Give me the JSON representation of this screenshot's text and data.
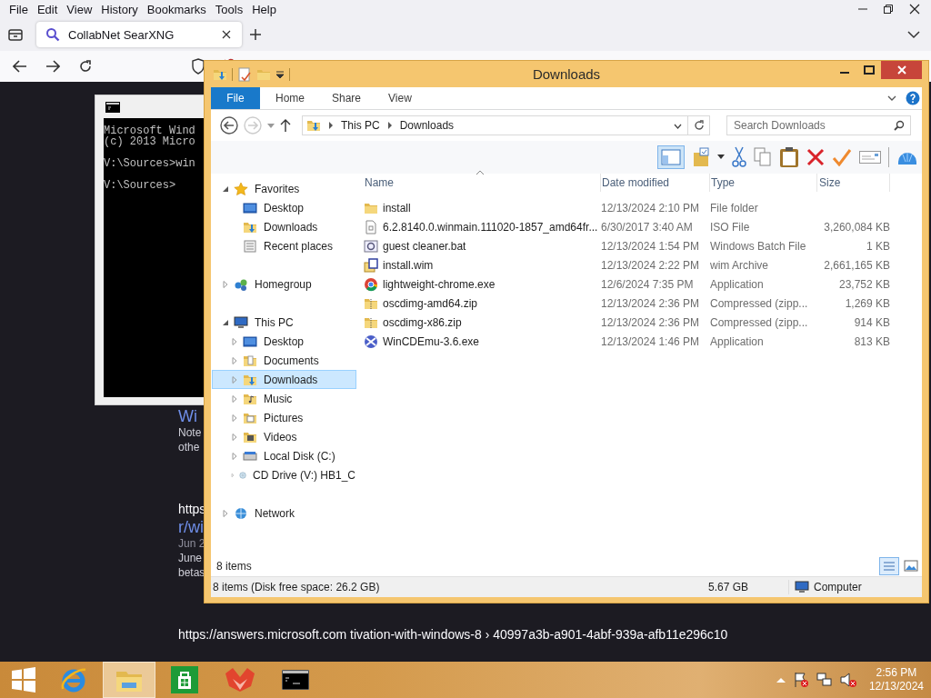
{
  "browser": {
    "menu": [
      "File",
      "Edit",
      "View",
      "History",
      "Bookmarks",
      "Tools",
      "Help"
    ],
    "tabs": [
      {
        "title": "CollabNet SearXNG",
        "selected": true
      }
    ],
    "results": [
      {
        "lines": [
          {
            "kind": "title",
            "text": "Wi"
          },
          {
            "kind": "snippet",
            "text": "Note"
          },
          {
            "kind": "snippet",
            "text": "othe"
          }
        ]
      },
      {
        "lines": [
          {
            "kind": "url",
            "text": "https"
          },
          {
            "kind": "title",
            "text": "r/wi"
          },
          {
            "kind": "date",
            "text": "Jun 2"
          },
          {
            "kind": "snippet",
            "text": "June"
          },
          {
            "kind": "snippet",
            "text": "betas"
          }
        ]
      },
      {
        "lines": [
          {
            "kind": "url",
            "text": "https://answers.microsoft.com  tivation-with-windows-8 › 40997a3b-a901-4abf-939a-afb11e296c10"
          }
        ]
      }
    ]
  },
  "console": {
    "paragraphs": [
      [
        "Microsoft Wind",
        "(c) 2013 Micro"
      ],
      [
        "V:\\Sources>win"
      ],
      [
        "V:\\Sources>"
      ]
    ]
  },
  "explorer": {
    "title": "Downloads",
    "ribbon_tabs": [
      {
        "label": "File",
        "kind": "file"
      },
      {
        "label": "Home",
        "kind": "tab"
      },
      {
        "label": "Share",
        "kind": "tab"
      },
      {
        "label": "View",
        "kind": "tab"
      }
    ],
    "breadcrumb": [
      "This PC",
      "Downloads"
    ],
    "search": {
      "placeholder": "Search Downloads"
    },
    "nav": [
      {
        "label": "Favorites",
        "kind": "star",
        "expanded": true,
        "selected": false,
        "children": [
          {
            "label": "Desktop",
            "kind": "desktop",
            "selected": false
          },
          {
            "label": "Downloads",
            "kind": "downloads",
            "selected": false
          },
          {
            "label": "Recent places",
            "kind": "recent",
            "selected": false
          }
        ]
      },
      {
        "label": "Homegroup",
        "kind": "homegroup",
        "expanded": false,
        "selected": false
      },
      {
        "label": "This PC",
        "kind": "computer",
        "expanded": true,
        "selected": false,
        "children": [
          {
            "label": "Desktop",
            "kind": "desktop",
            "expanded": false,
            "selected": false
          },
          {
            "label": "Documents",
            "kind": "documents",
            "expanded": false,
            "selected": false
          },
          {
            "label": "Downloads",
            "kind": "downloads",
            "expanded": false,
            "selected": true
          },
          {
            "label": "Music",
            "kind": "music",
            "expanded": false,
            "selected": false
          },
          {
            "label": "Pictures",
            "kind": "pictures",
            "expanded": false,
            "selected": false
          },
          {
            "label": "Videos",
            "kind": "videos",
            "expanded": false,
            "selected": false
          },
          {
            "label": "Local Disk (C:)",
            "kind": "disk",
            "expanded": false,
            "selected": false
          },
          {
            "label": "CD Drive (V:) HB1_C",
            "kind": "cd",
            "expanded": false,
            "selected": false
          }
        ]
      },
      {
        "label": "Network",
        "kind": "network",
        "expanded": false,
        "selected": false
      }
    ],
    "columns": [
      "Name",
      "Date modified",
      "Type",
      "Size"
    ],
    "files": [
      {
        "name": "install",
        "date": "12/13/2024 2:10 PM",
        "type": "File folder",
        "kind": "folder"
      },
      {
        "name": "6.2.8140.0.winmain.111020-1857_amd64fr...",
        "date": "6/30/2017 3:40 AM",
        "type": "ISO File",
        "size": "3,260,084 KB",
        "kind": "iso"
      },
      {
        "name": "guest cleaner.bat",
        "date": "12/13/2024 1:54 PM",
        "type": "Windows Batch File",
        "size": "1 KB",
        "kind": "batch"
      },
      {
        "name": "install.wim",
        "date": "12/13/2024 2:22 PM",
        "type": "wim Archive",
        "size": "2,661,165 KB",
        "kind": "wim"
      },
      {
        "name": "lightweight-chrome.exe",
        "date": "12/6/2024 7:35 PM",
        "type": "Application",
        "size": "23,752 KB",
        "kind": "browser"
      },
      {
        "name": "oscdimg-amd64.zip",
        "date": "12/13/2024 2:36 PM",
        "type": "Compressed (zipp...",
        "size": "1,269 KB",
        "kind": "zip"
      },
      {
        "name": "oscdimg-x86.zip",
        "date": "12/13/2024 2:36 PM",
        "type": "Compressed (zipp...",
        "size": "914 KB",
        "kind": "zip"
      },
      {
        "name": "WinCDEmu-3.6.exe",
        "date": "12/13/2024 1:46 PM",
        "type": "Application",
        "size": "813 KB",
        "kind": "setup"
      }
    ],
    "item_count": "8 items",
    "status": {
      "summary": "8 items (Disk free space: 26.2 GB)",
      "size": "5.67 GB",
      "location": "Computer"
    }
  },
  "taskbar": {
    "apps": [
      {
        "kind": "ie",
        "selected": false
      },
      {
        "kind": "explorer",
        "selected": true
      },
      {
        "kind": "store",
        "selected": false
      },
      {
        "kind": "fox",
        "selected": false
      },
      {
        "kind": "console",
        "selected": false
      }
    ],
    "clock": {
      "time": "2:56 PM",
      "date": "12/13/2024"
    }
  }
}
